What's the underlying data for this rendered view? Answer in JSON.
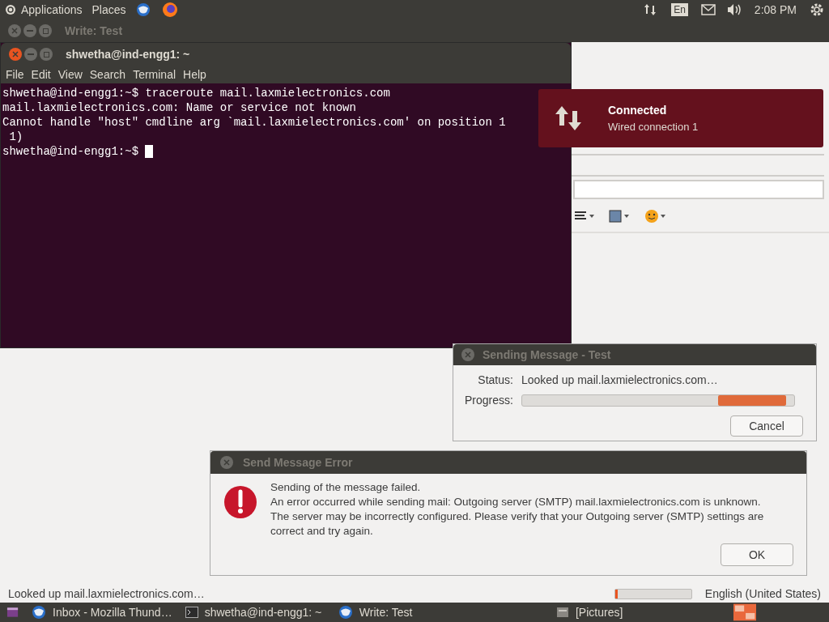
{
  "top_panel": {
    "menus": [
      "Applications",
      "Places"
    ],
    "keyboard": "En",
    "clock": "2:08 PM"
  },
  "compose_window": {
    "title": "Write: Test",
    "focused": false
  },
  "terminal": {
    "title": "shwetha@ind-engg1: ~",
    "focused": true,
    "menu": [
      "File",
      "Edit",
      "View",
      "Search",
      "Terminal",
      "Help"
    ],
    "lines": [
      "shwetha@ind-engg1:~$ traceroute mail.laxmielectronics.com",
      "mail.laxmielectronics.com: Name or service not known",
      "Cannot handle \"host\" cmdline arg `mail.laxmielectronics.com' on position 1",
      " 1)"
    ],
    "prompt": "shwetha@ind-engg1:~$ "
  },
  "notification": {
    "title": "Connected",
    "body": "Wired connection 1"
  },
  "sending_dialog": {
    "title": "Sending Message - Test",
    "status_label": "Status:",
    "status": "Looked up mail.laxmielectronics.com…",
    "progress_label": "Progress:",
    "button": "Cancel"
  },
  "error_dialog": {
    "title": "Send Message Error",
    "heading": "Sending of the message failed.",
    "message": "An error occurred while sending mail: Outgoing server (SMTP) mail.laxmielectronics.com is unknown. The server may be incorrectly configured. Please verify that your Outgoing server (SMTP) settings are correct and try again.",
    "button": "OK"
  },
  "status_bar": {
    "text": "Looked up mail.laxmielectronics.com…",
    "level": 0.03,
    "language": "English (United States)"
  },
  "taskbar": [
    {
      "kind": "mail",
      "label": "Inbox - Mozilla Thund…"
    },
    {
      "kind": "terminal",
      "label": "shwetha@ind-engg1: ~"
    },
    {
      "kind": "mail",
      "label": "Write: Test"
    },
    {
      "kind": "files",
      "label": "[Pictures]"
    }
  ]
}
